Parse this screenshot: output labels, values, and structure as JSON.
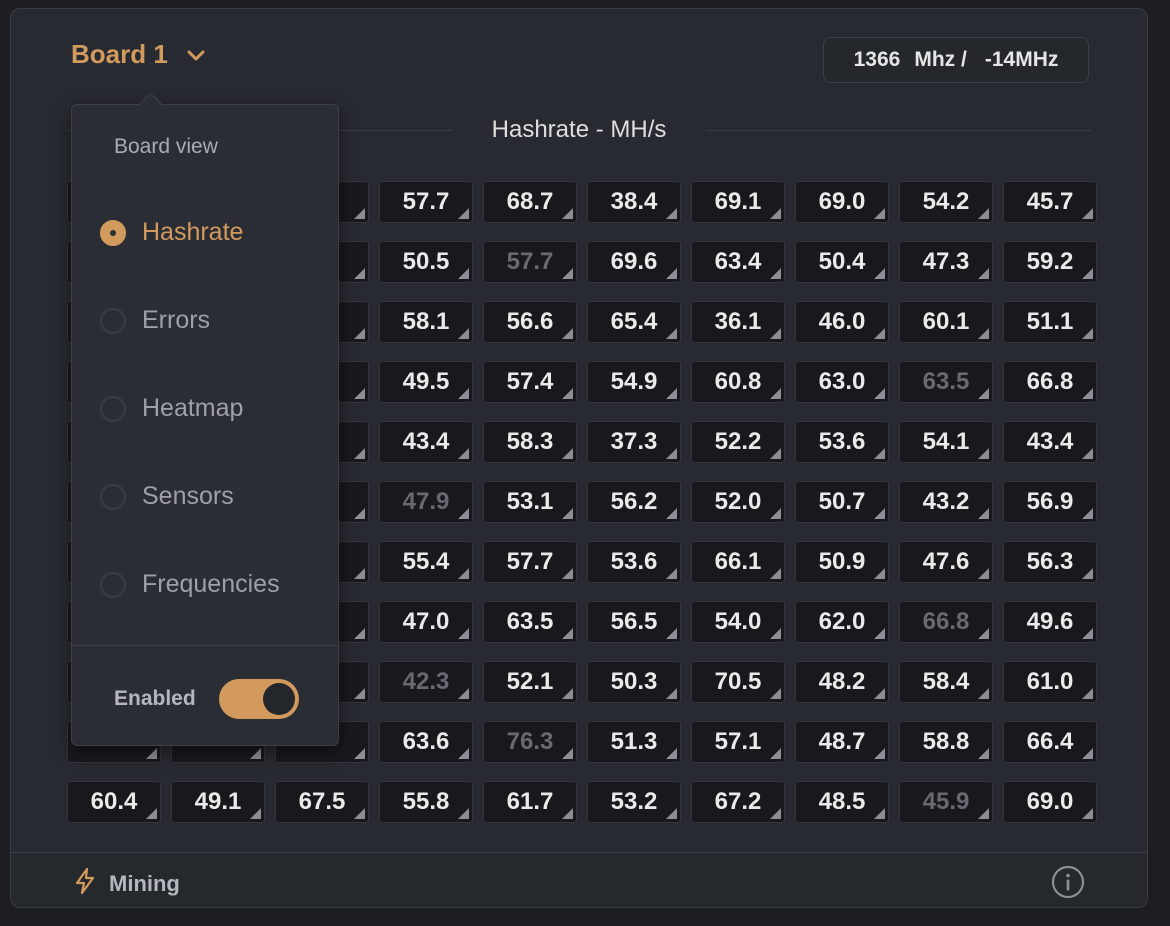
{
  "board": {
    "selected": "Board 1"
  },
  "frequency": {
    "value": "1366",
    "unit": "Mhz /",
    "delta": "-14MHz"
  },
  "chart": {
    "title": "Hashrate - MH/s"
  },
  "grid": {
    "rows": [
      [
        {
          "v": "",
          "d": false
        },
        {
          "v": "",
          "d": false
        },
        {
          "v": "",
          "d": false
        },
        {
          "v": "57.7",
          "d": false
        },
        {
          "v": "68.7",
          "d": false
        },
        {
          "v": "38.4",
          "d": false
        },
        {
          "v": "69.1",
          "d": false
        },
        {
          "v": "69.0",
          "d": false
        },
        {
          "v": "54.2",
          "d": false
        },
        {
          "v": "45.7",
          "d": false
        }
      ],
      [
        {
          "v": "",
          "d": false
        },
        {
          "v": "",
          "d": false
        },
        {
          "v": "",
          "d": false
        },
        {
          "v": "50.5",
          "d": false
        },
        {
          "v": "57.7",
          "d": true
        },
        {
          "v": "69.6",
          "d": false
        },
        {
          "v": "63.4",
          "d": false
        },
        {
          "v": "50.4",
          "d": false
        },
        {
          "v": "47.3",
          "d": false
        },
        {
          "v": "59.2",
          "d": false
        }
      ],
      [
        {
          "v": "",
          "d": false
        },
        {
          "v": "",
          "d": false
        },
        {
          "v": "",
          "d": false
        },
        {
          "v": "58.1",
          "d": false
        },
        {
          "v": "56.6",
          "d": false
        },
        {
          "v": "65.4",
          "d": false
        },
        {
          "v": "36.1",
          "d": false
        },
        {
          "v": "46.0",
          "d": false
        },
        {
          "v": "60.1",
          "d": false
        },
        {
          "v": "51.1",
          "d": false
        }
      ],
      [
        {
          "v": "",
          "d": false
        },
        {
          "v": "",
          "d": false
        },
        {
          "v": "",
          "d": false
        },
        {
          "v": "49.5",
          "d": false
        },
        {
          "v": "57.4",
          "d": false
        },
        {
          "v": "54.9",
          "d": false
        },
        {
          "v": "60.8",
          "d": false
        },
        {
          "v": "63.0",
          "d": false
        },
        {
          "v": "63.5",
          "d": true
        },
        {
          "v": "66.8",
          "d": false
        }
      ],
      [
        {
          "v": "",
          "d": false
        },
        {
          "v": "",
          "d": false
        },
        {
          "v": "",
          "d": false
        },
        {
          "v": "43.4",
          "d": false
        },
        {
          "v": "58.3",
          "d": false
        },
        {
          "v": "37.3",
          "d": false
        },
        {
          "v": "52.2",
          "d": false
        },
        {
          "v": "53.6",
          "d": false
        },
        {
          "v": "54.1",
          "d": false
        },
        {
          "v": "43.4",
          "d": false
        }
      ],
      [
        {
          "v": "",
          "d": false
        },
        {
          "v": "",
          "d": false
        },
        {
          "v": "",
          "d": false
        },
        {
          "v": "47.9",
          "d": true
        },
        {
          "v": "53.1",
          "d": false
        },
        {
          "v": "56.2",
          "d": false
        },
        {
          "v": "52.0",
          "d": false
        },
        {
          "v": "50.7",
          "d": false
        },
        {
          "v": "43.2",
          "d": false
        },
        {
          "v": "56.9",
          "d": false
        }
      ],
      [
        {
          "v": "",
          "d": false
        },
        {
          "v": "",
          "d": false
        },
        {
          "v": "",
          "d": false
        },
        {
          "v": "55.4",
          "d": false
        },
        {
          "v": "57.7",
          "d": false
        },
        {
          "v": "53.6",
          "d": false
        },
        {
          "v": "66.1",
          "d": false
        },
        {
          "v": "50.9",
          "d": false
        },
        {
          "v": "47.6",
          "d": false
        },
        {
          "v": "56.3",
          "d": false
        }
      ],
      [
        {
          "v": "",
          "d": false
        },
        {
          "v": "",
          "d": false
        },
        {
          "v": "",
          "d": false
        },
        {
          "v": "47.0",
          "d": false
        },
        {
          "v": "63.5",
          "d": false
        },
        {
          "v": "56.5",
          "d": false
        },
        {
          "v": "54.0",
          "d": false
        },
        {
          "v": "62.0",
          "d": false
        },
        {
          "v": "66.8",
          "d": true
        },
        {
          "v": "49.6",
          "d": false
        }
      ],
      [
        {
          "v": "",
          "d": false
        },
        {
          "v": "",
          "d": false
        },
        {
          "v": "",
          "d": false
        },
        {
          "v": "42.3",
          "d": true
        },
        {
          "v": "52.1",
          "d": false
        },
        {
          "v": "50.3",
          "d": false
        },
        {
          "v": "70.5",
          "d": false
        },
        {
          "v": "48.2",
          "d": false
        },
        {
          "v": "58.4",
          "d": false
        },
        {
          "v": "61.0",
          "d": false
        }
      ],
      [
        {
          "v": "",
          "d": false
        },
        {
          "v": "",
          "d": false
        },
        {
          "v": "",
          "d": false
        },
        {
          "v": "63.6",
          "d": false
        },
        {
          "v": "76.3",
          "d": true
        },
        {
          "v": "51.3",
          "d": false
        },
        {
          "v": "57.1",
          "d": false
        },
        {
          "v": "48.7",
          "d": false
        },
        {
          "v": "58.8",
          "d": false
        },
        {
          "v": "66.4",
          "d": false
        }
      ],
      [
        {
          "v": "60.4",
          "d": false
        },
        {
          "v": "49.1",
          "d": false
        },
        {
          "v": "67.5",
          "d": false
        },
        {
          "v": "55.8",
          "d": false
        },
        {
          "v": "61.7",
          "d": false
        },
        {
          "v": "53.2",
          "d": false
        },
        {
          "v": "67.2",
          "d": false
        },
        {
          "v": "48.5",
          "d": false
        },
        {
          "v": "45.9",
          "d": true
        },
        {
          "v": "69.0",
          "d": false
        }
      ]
    ]
  },
  "dropdown": {
    "heading": "Board view",
    "options": [
      {
        "label": "Hashrate",
        "selected": true
      },
      {
        "label": "Errors",
        "selected": false
      },
      {
        "label": "Heatmap",
        "selected": false
      },
      {
        "label": "Sensors",
        "selected": false
      },
      {
        "label": "Frequencies",
        "selected": false
      }
    ],
    "enabled_label": "Enabled",
    "enabled": true
  },
  "footer": {
    "status": "Mining"
  },
  "colors": {
    "accent": "#d39a5e",
    "background": "#272a30",
    "cell": "#17191d",
    "dim_text": "#676a70"
  },
  "icons": {
    "board_select": "chevron-down-icon",
    "status": "lightning-icon",
    "info": "info-icon"
  }
}
